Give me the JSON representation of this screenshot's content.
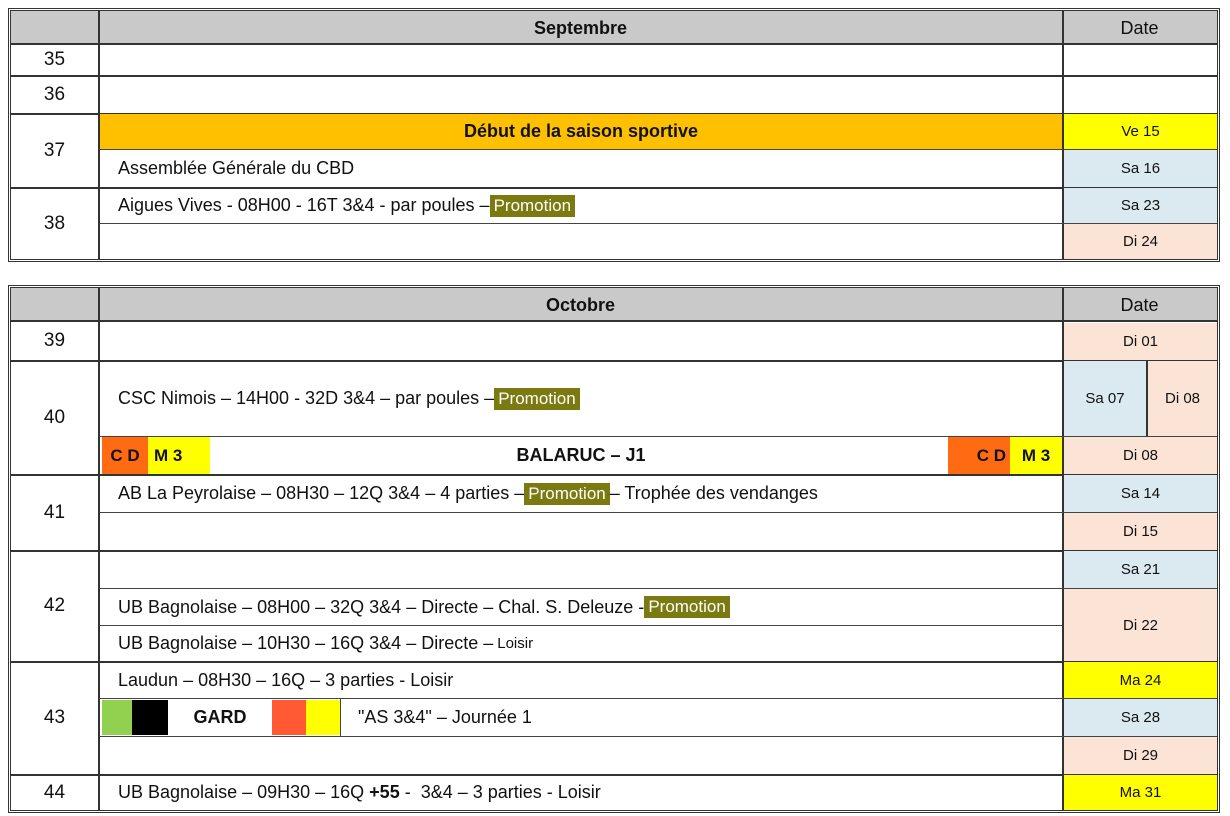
{
  "colors": {
    "header_bg": "#c9c9c9",
    "highlight_orange": "#ffc000",
    "date_yellow": "#ffff00",
    "date_blue": "#dbe9f1",
    "date_peach": "#fbe3d6",
    "promotion_bg": "#7b7a11",
    "cd_orange": "#ff6a13",
    "gard_green": "#92d050",
    "gard_black": "#000000",
    "gard_red": "#ff5a33",
    "gard_yellow": "#ffff00"
  },
  "septembre": {
    "title": "Septembre",
    "date_header": "Date",
    "w35": "35",
    "w36": "36",
    "w37": "37",
    "w38": "38",
    "saison": "Début de la saison sportive",
    "saison_date": "Ve 15",
    "assemblee": "Assemblée Générale du CBD",
    "assemblee_date": "Sa 16",
    "aigues": "Aigues Vives - 08H00 - 16T 3&4 - par poules – ",
    "promotion": "Promotion",
    "aigues_date": "Sa 23",
    "di24": "Di 24"
  },
  "octobre": {
    "title": "Octobre",
    "date_header": "Date",
    "w39": "39",
    "w40": "40",
    "w41": "41",
    "w42": "42",
    "w43": "43",
    "w44": "44",
    "di01": "Di 01",
    "csc": "CSC  Nimois – 14H00 - 32D 3&4 – par poules – ",
    "promotion": "Promotion",
    "sa07": "Sa 07",
    "di08a": "Di 08",
    "cd": "C D",
    "m3": "M 3",
    "balaruc": "BALARUC – J1",
    "di08b": "Di 08",
    "ab": "AB La Peyrolaise – 08H30 – 12Q 3&4 – 4 parties – ",
    "ab_tail": " – Trophée des vendanges",
    "sa14": "Sa 14",
    "di15": "Di 15",
    "sa21": "Sa 21",
    "ub1": "UB Bagnolaise – 08H00 – 32Q 3&4 – Directe – Chal. S. Deleuze - ",
    "ub2": "UB Bagnolaise – 10H30 – 16Q 3&4 – Directe – ",
    "loisir": "Loisir",
    "di22": "Di 22",
    "laudun": "Laudun – 08H30 – 16Q – 3 parties - Loisir",
    "ma24": "Ma 24",
    "gard": "GARD",
    "as34": "\"AS 3&4\" – Journée 1",
    "sa28": "Sa 28",
    "di29": "Di 29",
    "ub3_a": "UB Bagnolaise – 09H30 – 16Q ",
    "ub3_b": "+55",
    "ub3_c": " -  3&4 – 3 parties - Loisir",
    "ma31": "Ma 31"
  }
}
